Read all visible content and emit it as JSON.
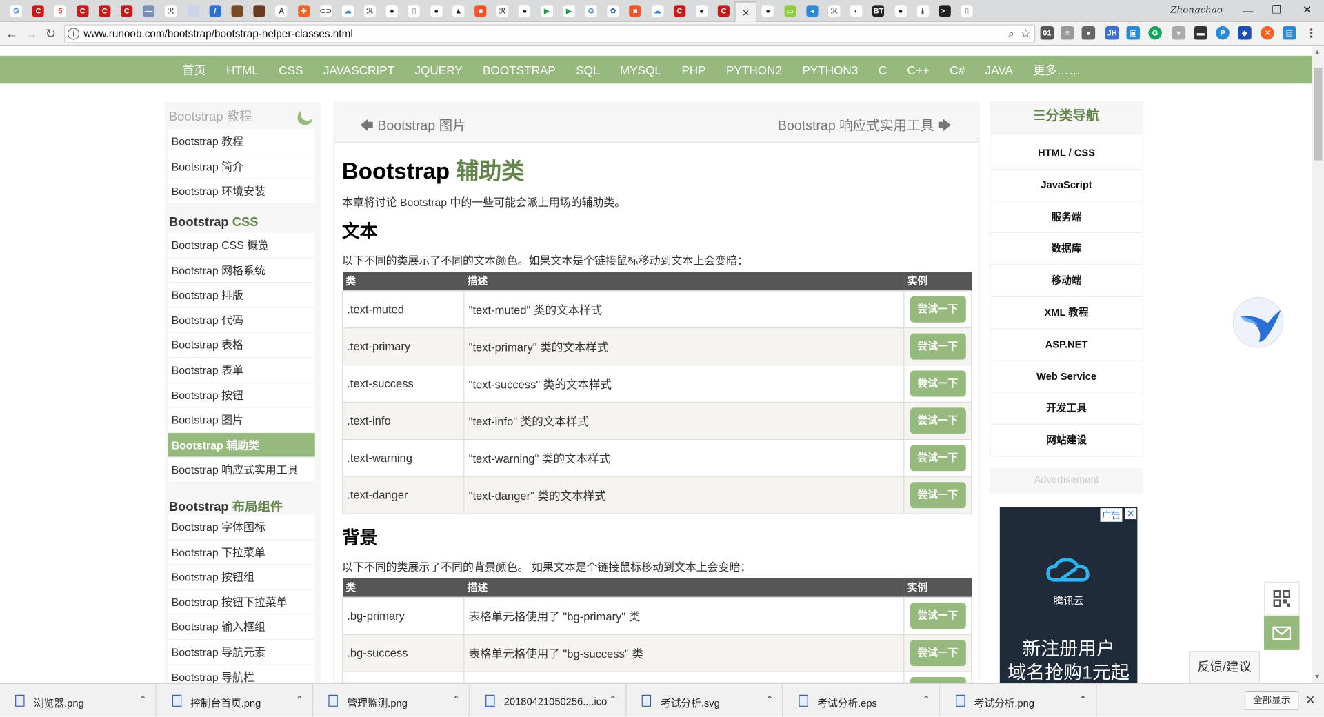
{
  "browser": {
    "tab_favicons": [
      {
        "icon": "google-icon",
        "color": "#ffffff",
        "glyph": "G",
        "fg": "#4285f4"
      },
      {
        "icon": "csdn-icon",
        "color": "#c91a1a",
        "glyph": "C"
      },
      {
        "icon": "5-icon",
        "color": "#ffffff",
        "glyph": "5",
        "fg": "#e33"
      },
      {
        "icon": "csdn-icon",
        "color": "#c91a1a",
        "glyph": "C"
      },
      {
        "icon": "csdn-icon",
        "color": "#c91a1a",
        "glyph": "C"
      },
      {
        "icon": "csdn-icon",
        "color": "#c91a1a",
        "glyph": "C"
      },
      {
        "icon": "page-icon",
        "color": "#7a8fb5",
        "glyph": "—"
      },
      {
        "icon": "runoob-icon",
        "color": "#ffffff",
        "glyph": "ℛ",
        "fg": "#555"
      },
      {
        "icon": "blank-icon",
        "color": "#c9d2e6",
        "glyph": ""
      },
      {
        "icon": "edit-icon",
        "color": "#2f6fcf",
        "glyph": "/"
      },
      {
        "icon": "image-icon",
        "color": "#7a4a2a",
        "glyph": ""
      },
      {
        "icon": "image-icon",
        "color": "#6b3b20",
        "glyph": ""
      },
      {
        "icon": "tree-icon",
        "color": "#ffffff",
        "glyph": "A",
        "fg": "#333"
      },
      {
        "icon": "puzzle-icon",
        "color": "#f26522",
        "glyph": "✚"
      },
      {
        "icon": "code-icon",
        "color": "#ffffff",
        "glyph": "⊂⊃",
        "fg": "#333"
      },
      {
        "icon": "cloud-icon",
        "color": "#ffffff",
        "glyph": "☁",
        "fg": "#2a8ad6"
      },
      {
        "icon": "runoob-icon",
        "color": "#ffffff",
        "glyph": "ℛ",
        "fg": "#555"
      },
      {
        "icon": "github-icon",
        "color": "#ffffff",
        "glyph": "●",
        "fg": "#222"
      },
      {
        "icon": "doc-icon",
        "color": "#ffffff",
        "glyph": "▯",
        "fg": "#777"
      },
      {
        "icon": "github-icon",
        "color": "#ffffff",
        "glyph": "●",
        "fg": "#222"
      },
      {
        "icon": "wolf-icon",
        "color": "#ffffff",
        "glyph": "▲",
        "fg": "#222"
      },
      {
        "icon": "windows-icon",
        "color": "#f35325",
        "glyph": "■"
      },
      {
        "icon": "runoob-icon",
        "color": "#ffffff",
        "glyph": "ℛ",
        "fg": "#555"
      },
      {
        "icon": "github-icon",
        "color": "#ffffff",
        "glyph": "●",
        "fg": "#222"
      },
      {
        "icon": "play-icon",
        "color": "#ffffff",
        "glyph": "▶",
        "fg": "#1e9e4a"
      },
      {
        "icon": "play-icon",
        "color": "#ffffff",
        "glyph": "▶",
        "fg": "#1e9e4a"
      },
      {
        "icon": "google-icon",
        "color": "#ffffff",
        "glyph": "G",
        "fg": "#4285f4"
      },
      {
        "icon": "baidu-icon",
        "color": "#ffffff",
        "glyph": "✿",
        "fg": "#2f5fd0"
      },
      {
        "icon": "windows-icon",
        "color": "#f35325",
        "glyph": "■"
      },
      {
        "icon": "cloud-icon",
        "color": "#ffffff",
        "glyph": "☁",
        "fg": "#2a8ad6"
      },
      {
        "icon": "csdn-icon",
        "color": "#c91a1a",
        "glyph": "C"
      },
      {
        "icon": "github-icon",
        "color": "#ffffff",
        "glyph": "●",
        "fg": "#222"
      },
      {
        "icon": "csdn-icon",
        "color": "#c91a1a",
        "glyph": "C"
      },
      {
        "icon": "close-tab-icon",
        "color": "transparent",
        "glyph": "×",
        "fg": "#333",
        "active": true
      },
      {
        "icon": "github-icon",
        "color": "#ffffff",
        "glyph": "●",
        "fg": "#222"
      },
      {
        "icon": "green-icon",
        "color": "#8ccf3a",
        "glyph": "▭"
      },
      {
        "icon": "blue-icon",
        "color": "#2a8ad6",
        "glyph": "◂"
      },
      {
        "icon": "runoob-icon",
        "color": "#ffffff",
        "glyph": "ℛ",
        "fg": "#555"
      },
      {
        "icon": "media-icon",
        "color": "#ffffff",
        "glyph": "◐",
        "fg": "#333"
      },
      {
        "icon": "bt-icon",
        "color": "#222222",
        "glyph": "BT"
      },
      {
        "icon": "github-icon",
        "color": "#ffffff",
        "glyph": "●",
        "fg": "#222"
      },
      {
        "icon": "download-icon",
        "color": "#ffffff",
        "glyph": "⭳",
        "fg": "#333"
      },
      {
        "icon": "terminal-icon",
        "color": "#222222",
        "glyph": ">_"
      },
      {
        "icon": "doc-icon",
        "color": "#ffffff",
        "glyph": "▯",
        "fg": "#777"
      }
    ],
    "profile_name": "Zhongchao",
    "url": "www.runoob.com/bootstrap/bootstrap-helper-classes.html"
  },
  "site_nav": [
    "首页",
    "HTML",
    "CSS",
    "JAVASCRIPT",
    "JQUERY",
    "BOOTSTRAP",
    "SQL",
    "MYSQL",
    "PHP",
    "PYTHON2",
    "PYTHON3",
    "C",
    "C++",
    "C#",
    "JAVA",
    "更多……"
  ],
  "left_sidebar": {
    "header": "Bootstrap 教程",
    "group1": [
      "Bootstrap 教程",
      "Bootstrap 简介",
      "Bootstrap 环境安装"
    ],
    "section_css_prefix": "Bootstrap",
    "section_css_accent": "CSS",
    "group2": [
      "Bootstrap CSS 概览",
      "Bootstrap 网格系统",
      "Bootstrap 排版",
      "Bootstrap 代码",
      "Bootstrap 表格",
      "Bootstrap 表单",
      "Bootstrap 按钮",
      "Bootstrap 图片",
      "Bootstrap 辅助类",
      "Bootstrap 响应式实用工具"
    ],
    "active_item": "Bootstrap 辅助类",
    "section_layout_prefix": "Bootstrap",
    "section_layout_accent": "布局组件",
    "group3": [
      "Bootstrap 字体图标",
      "Bootstrap 下拉菜单",
      "Bootstrap 按钮组",
      "Bootstrap 按钮下拉菜单",
      "Bootstrap 输入框组",
      "Bootstrap 导航元素",
      "Bootstrap 导航栏"
    ]
  },
  "main": {
    "prev": "Bootstrap 图片",
    "next": "Bootstrap 响应式实用工具",
    "title_prefix": "Bootstrap",
    "title_accent": "辅助类",
    "intro": "本章将讨论 Bootstrap 中的一些可能会派上用场的辅助类。",
    "text_heading": "文本",
    "text_desc": "以下不同的类展示了不同的文本颜色。如果文本是个链接鼠标移动到文本上会变暗：",
    "table_headers": [
      "类",
      "描述",
      "实例"
    ],
    "try_label": "尝试一下",
    "text_rows": [
      [
        ".text-muted",
        "\"text-muted\" 类的文本样式"
      ],
      [
        ".text-primary",
        "\"text-primary\" 类的文本样式"
      ],
      [
        ".text-success",
        "\"text-success\" 类的文本样式"
      ],
      [
        ".text-info",
        "\"text-info\" 类的文本样式"
      ],
      [
        ".text-warning",
        "\"text-warning\" 类的文本样式"
      ],
      [
        ".text-danger",
        "\"text-danger\" 类的文本样式"
      ]
    ],
    "bg_heading": "背景",
    "bg_desc": "以下不同的类展示了不同的背景颜色。 如果文本是个链接鼠标移动到文本上会变暗：",
    "bg_rows": [
      [
        ".bg-primary",
        "表格单元格使用了 \"bg-primary\" 类"
      ],
      [
        ".bg-success",
        "表格单元格使用了 \"bg-success\" 类"
      ],
      [
        "",
        ""
      ]
    ]
  },
  "right_sidebar": {
    "header": "☰分类导航",
    "items": [
      "HTML / CSS",
      "JavaScript",
      "服务端",
      "数据库",
      "移动端",
      "XML 教程",
      "ASP.NET",
      "Web Service",
      "开发工具",
      "网站建设"
    ],
    "ad_header": "Advertisement",
    "ad_tag": "广告",
    "ad_close": "✕",
    "ad_brand": "腾讯云",
    "ad_line1": "新注册用户",
    "ad_line2": "域名抢购1元起"
  },
  "feedback_label": "反馈/建议",
  "downloads": {
    "items": [
      "浏览器.png",
      "控制台首页.png",
      "管理监测.png",
      "20180421050256....ico",
      "考试分析.svg",
      "考试分析.eps",
      "考试分析.png"
    ],
    "show_all": "全部显示"
  },
  "colors": {
    "accent": "#96b97d",
    "accent_dark": "#64854c",
    "table_head": "#555555"
  }
}
